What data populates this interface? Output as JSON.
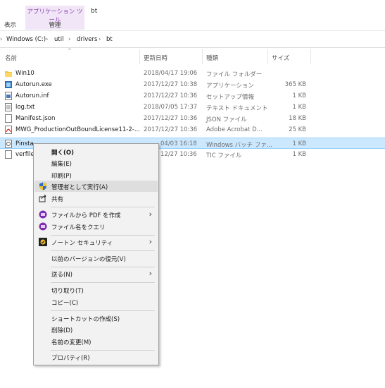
{
  "ribbon": {
    "context_tab_header": "アプリケーション ツール",
    "context_tab_label": "管理",
    "view_tab": "表示",
    "title": "bt"
  },
  "address": {
    "chevron": "›",
    "parts": [
      "Windows (C:)",
      "util",
      "drivers",
      "bt"
    ],
    "separator": "›"
  },
  "columns": {
    "name": "名前",
    "date": "更新日時",
    "type": "種類",
    "size": "サイズ"
  },
  "files": [
    {
      "name": "Win10",
      "date": "2018/04/17 19:06",
      "type": "ファイル フォルダー",
      "size": "",
      "icon": "folder-icon"
    },
    {
      "name": "Autorun.exe",
      "date": "2017/12/27 10:38",
      "type": "アプリケーション",
      "size": "365 KB",
      "icon": "exe-icon"
    },
    {
      "name": "Autorun.inf",
      "date": "2017/12/27 10:36",
      "type": "セットアップ情報",
      "size": "1 KB",
      "icon": "inf-icon"
    },
    {
      "name": "log.txt",
      "date": "2018/07/05 17:37",
      "type": "テキスト ドキュメント",
      "size": "1 KB",
      "icon": "text-file-icon"
    },
    {
      "name": "Manifest.json",
      "date": "2017/12/27 10:36",
      "type": "JSON ファイル",
      "size": "18 KB",
      "icon": "file-icon"
    },
    {
      "name": "MWG_ProductionOutBoundLicense11-2-...",
      "date": "2017/12/27 10:36",
      "type": "Adobe Acrobat D...",
      "size": "25 KB",
      "icon": "pdf-icon"
    },
    {
      "name": "Pinsta",
      "date": "04/03 16:18",
      "type": "Windows バッチ ファ...",
      "size": "1 KB",
      "icon": "batch-file-icon"
    },
    {
      "name": "verfile",
      "date": "12/27 10:36",
      "type": "TIC ファイル",
      "size": "1 KB",
      "icon": "file-icon"
    }
  ],
  "context_menu": {
    "open": "開く(O)",
    "edit": "編集(E)",
    "print": "印刷(P)",
    "run_as_admin": "管理者として実行(A)",
    "share": "共有",
    "create_pdf": "ファイルから PDF を作成",
    "quilt_name": "ファイル名をクエリ",
    "norton": "ノートン セキュリティ",
    "restore_versions": "以前のバージョンの復元(V)",
    "send_to": "送る(N)",
    "cut": "切り取り(T)",
    "copy": "コピー(C)",
    "create_shortcut": "ショートカットの作成(S)",
    "delete": "削除(D)",
    "rename": "名前の変更(M)",
    "properties": "プロパティ(R)",
    "submenu_arrow": "›"
  },
  "colors": {
    "selection": "#cce8ff",
    "context_tab": "#f1e6f7",
    "context_tab_text": "#8a3fa8"
  }
}
